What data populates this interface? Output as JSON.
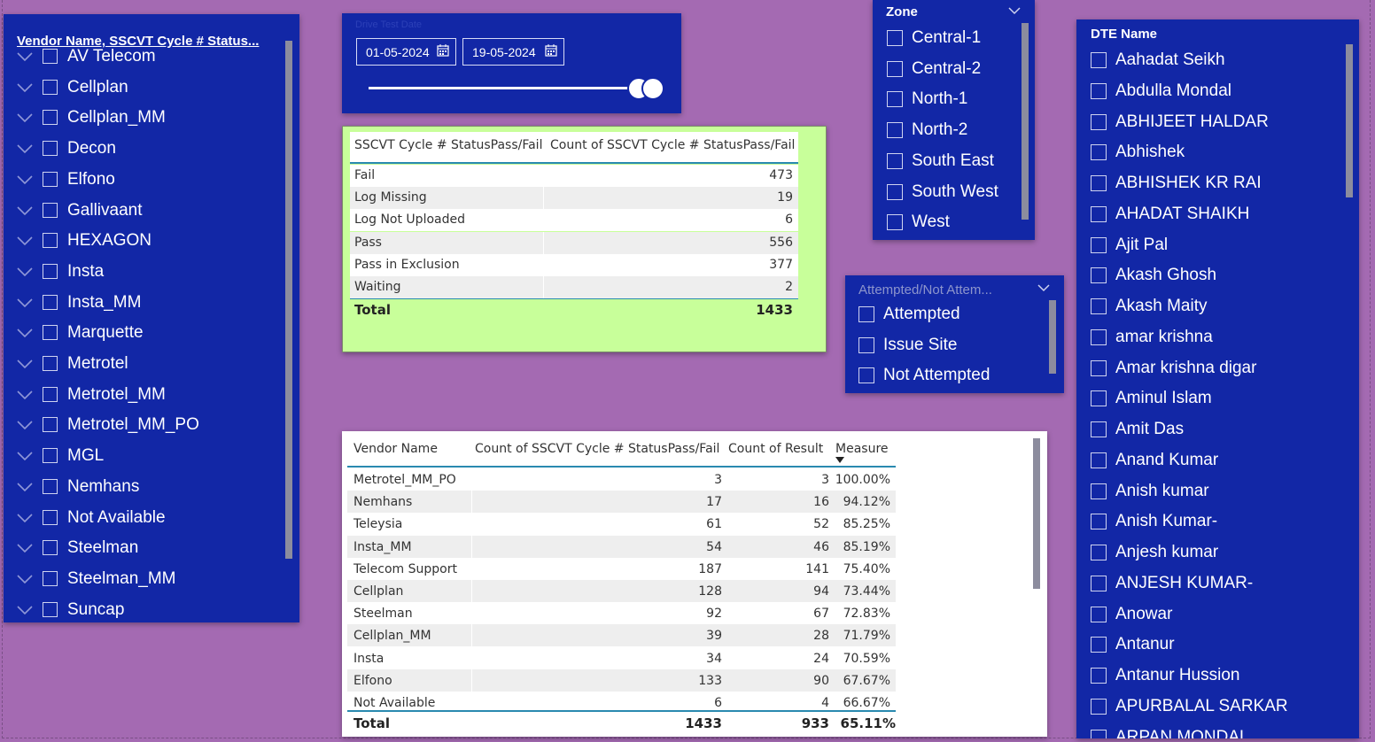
{
  "vendor_slicer": {
    "title": "Vendor Name, SSCVT Cycle # Status...",
    "items": [
      "AV Telecom",
      "Cellplan",
      "Cellplan_MM",
      "Decon",
      "Elfono",
      "Gallivaant",
      "HEXAGON",
      "Insta",
      "Insta_MM",
      "Marquette",
      "Metrotel",
      "Metrotel_MM",
      "Metrotel_MM_PO",
      "MGL",
      "Nemhans",
      "Not Available",
      "Steelman",
      "Steelman_MM",
      "Suncap"
    ]
  },
  "date_slicer": {
    "title": "Drive Test Date",
    "start": "01-05-2024",
    "end": "19-05-2024"
  },
  "summary_table": {
    "headers": [
      "SSCVT Cycle # StatusPass/Fail",
      "Count of SSCVT Cycle # StatusPass/Fail"
    ],
    "rows": [
      {
        "status": "Fail",
        "count": "473"
      },
      {
        "status": "Log Missing",
        "count": "19"
      },
      {
        "status": "Log Not Uploaded",
        "count": "6"
      },
      {
        "status": "Pass",
        "count": "556"
      },
      {
        "status": "Pass in Exclusion",
        "count": "377"
      },
      {
        "status": "Waiting",
        "count": "2"
      }
    ],
    "total_label": "Total",
    "total_value": "1433",
    "background": "#c8ff9a"
  },
  "zone_slicer": {
    "title": "Zone",
    "items": [
      "Central-1",
      "Central-2",
      "North-1",
      "North-2",
      "South East",
      "South West",
      "West"
    ]
  },
  "attempt_slicer": {
    "title": "Attempted/Not Attem...",
    "items": [
      "Attempted",
      "Issue Site",
      "Not Attempted"
    ]
  },
  "vendor_table": {
    "headers": [
      "Vendor Name",
      "Count of SSCVT Cycle # StatusPass/Fail",
      "Count of Result",
      "Measure"
    ],
    "rows": [
      {
        "vendor": "Metrotel_MM_PO",
        "count": "3",
        "result": "3",
        "measure": "100.00%"
      },
      {
        "vendor": "Nemhans",
        "count": "17",
        "result": "16",
        "measure": "94.12%"
      },
      {
        "vendor": "Teleysia",
        "count": "61",
        "result": "52",
        "measure": "85.25%"
      },
      {
        "vendor": "Insta_MM",
        "count": "54",
        "result": "46",
        "measure": "85.19%"
      },
      {
        "vendor": "Telecom Support",
        "count": "187",
        "result": "141",
        "measure": "75.40%"
      },
      {
        "vendor": "Cellplan",
        "count": "128",
        "result": "94",
        "measure": "73.44%"
      },
      {
        "vendor": "Steelman",
        "count": "92",
        "result": "67",
        "measure": "72.83%"
      },
      {
        "vendor": "Cellplan_MM",
        "count": "39",
        "result": "28",
        "measure": "71.79%"
      },
      {
        "vendor": "Insta",
        "count": "34",
        "result": "24",
        "measure": "70.59%"
      },
      {
        "vendor": "Elfono",
        "count": "133",
        "result": "90",
        "measure": "67.67%"
      },
      {
        "vendor": "Not Available",
        "count": "6",
        "result": "4",
        "measure": "66.67%"
      }
    ],
    "total": {
      "label": "Total",
      "count": "1433",
      "result": "933",
      "measure": "65.11%"
    }
  },
  "dte_slicer": {
    "title": "DTE Name",
    "items": [
      "Aahadat Seikh",
      "Abdulla Mondal",
      "ABHIJEET HALDAR",
      "Abhishek",
      "ABHISHEK KR RAI",
      "AHADAT SHAIKH",
      "Ajit Pal",
      "Akash Ghosh",
      "Akash Maity",
      "amar krishna",
      "Amar krishna digar",
      "Aminul Islam",
      "Amit Das",
      "Anand Kumar",
      "Anish kumar",
      "Anish Kumar-",
      "Anjesh kumar",
      "ANJESH KUMAR-",
      "Anowar",
      "Antanur",
      "Antanur Hussion",
      "APURBALAL SARKAR",
      "ARPAN MONDAL"
    ]
  },
  "colors": {
    "canvas": "#a46ab2",
    "slicer_bg": "#1227a6",
    "table_header_rule": "#2a8ab0"
  }
}
